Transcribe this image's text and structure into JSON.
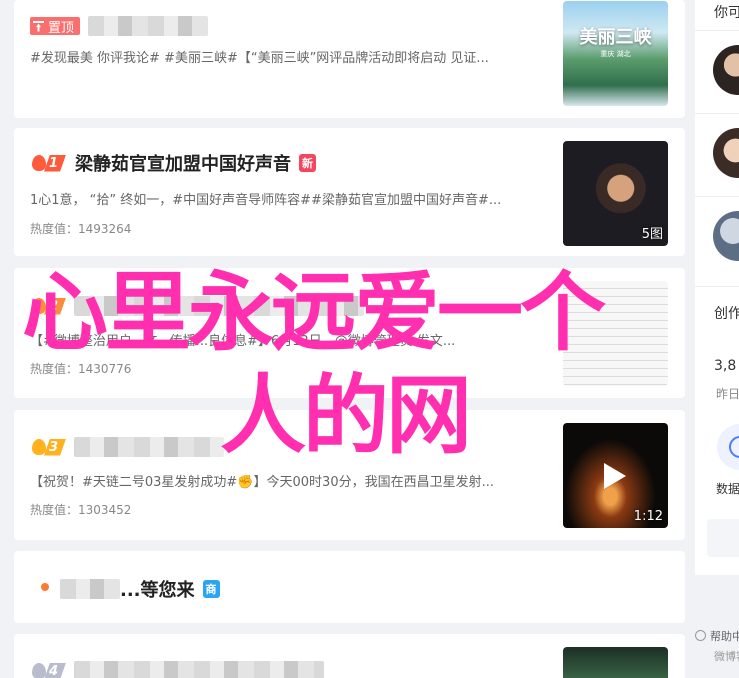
{
  "feed": {
    "items": [
      {
        "pinned_label": "置顶",
        "desc": "#发现最美 你评我论# #美丽三峡#【“美丽三峡”网评品牌活动即将启动 见证...",
        "thumb_poster": "美丽三峡",
        "thumb_sub": "重庆 湖北"
      },
      {
        "rank": "1",
        "title": "梁静茹官宣加盟中国好声音",
        "badge": "新",
        "desc": "1心1意， “拾” 终如一，#中国好声音导师阵容##梁静茹官宣加盟中国好声音#...",
        "heat": "热度值：1493264",
        "thumb_label": "5图"
      },
      {
        "rank": "2",
        "desc": "【#微博整治用户...文...传播...良信息#】6月12日，@微博管理员 发文...",
        "heat": "热度值：1430776"
      },
      {
        "rank": "3",
        "desc": "【祝贺！#天链二号03星发射成功#✊】今天00时30分，我国在西昌卫星发射...",
        "heat": "热度值：1303452",
        "thumb_label": "1:12"
      },
      {
        "title": "...等您来",
        "badge": "商"
      },
      {
        "rank": "4"
      }
    ]
  },
  "sidebar": {
    "header": "你可",
    "section_label": "创作",
    "stat_value": "3,8",
    "stat_label": "昨日",
    "data_label": "数据",
    "help_label": "帮助中",
    "weibo_label": "微博客"
  },
  "overlay": {
    "line1": "心里永远爱一个",
    "line2": "人的网"
  },
  "colors": {
    "accent_red": "#f5465f",
    "flame_1": "#ff5a3c",
    "flame_2": "#ff8a3c",
    "flame_3": "#ffb21e",
    "flame_4": "#b9bccc",
    "overlay": "#ff2fb0"
  }
}
